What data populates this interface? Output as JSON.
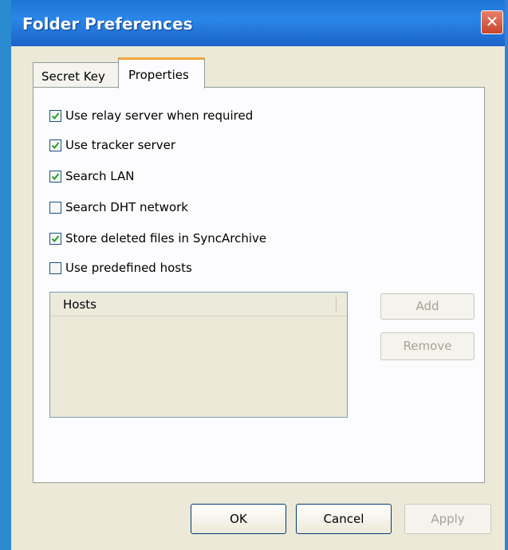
{
  "window": {
    "title": "Folder Preferences",
    "close_glyph": "✕"
  },
  "tabs": [
    {
      "label": "Secret Key",
      "selected": false
    },
    {
      "label": "Properties",
      "selected": true
    }
  ],
  "options": [
    {
      "label": "Use relay server when required",
      "checked": true
    },
    {
      "label": "Use tracker server",
      "checked": true
    },
    {
      "label": "Search LAN",
      "checked": true
    },
    {
      "label": "Search DHT network",
      "checked": false
    },
    {
      "label": "Store deleted files in SyncArchive",
      "checked": true
    },
    {
      "label": "Use predefined hosts",
      "checked": false
    }
  ],
  "hosts": {
    "column_header": "Hosts",
    "rows": []
  },
  "host_buttons": {
    "add_label": "Add",
    "remove_label": "Remove"
  },
  "footer": {
    "ok_label": "OK",
    "cancel_label": "Cancel",
    "apply_label": "Apply"
  },
  "colors": {
    "titlebar": "#2a86e8",
    "close_button": "#d9573e",
    "active_tab_accent": "#f2a73a",
    "checkmark": "#21a121"
  }
}
